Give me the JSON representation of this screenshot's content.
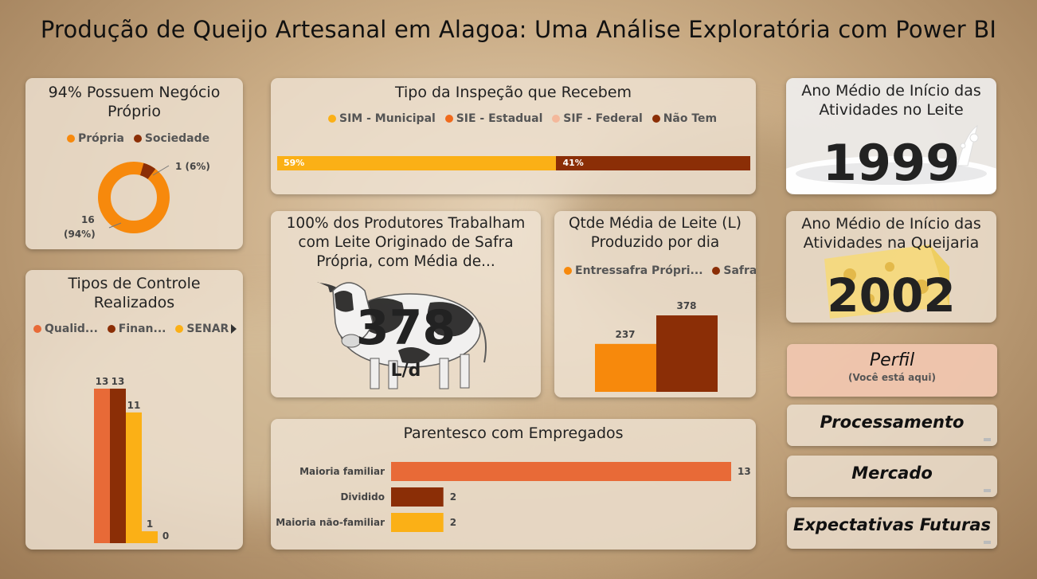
{
  "page_title": "Produção de Queijo Artesanal em Alagoa: Uma Análise Exploratória com Power BI",
  "colors": {
    "orange": "#F7890C",
    "darkred": "#8B2E06",
    "yellow": "#FBB016",
    "coral": "#E86A37",
    "salmon": "#F4B89B",
    "active_nav": "#F0C6AF"
  },
  "negocio": {
    "title": "94% Possuem Negócio Próprio",
    "legend": [
      {
        "label": "Própria",
        "color": "#F7890C"
      },
      {
        "label": "Sociedade",
        "color": "#8B2E06"
      }
    ],
    "slices": [
      {
        "label": "Própria",
        "value": 16,
        "pct": "(94%)",
        "display": "16"
      },
      {
        "label": "Sociedade",
        "value": 1,
        "display": "1 (6%)"
      }
    ]
  },
  "inspecao": {
    "title": "Tipo da Inspeção que Recebem",
    "legend": [
      {
        "label": "SIM - Municipal",
        "color": "#FBB016"
      },
      {
        "label": "SIE - Estadual",
        "color": "#F06A1C"
      },
      {
        "label": "SIF - Federal",
        "color": "#F4B89B"
      },
      {
        "label": "Não Tem",
        "color": "#8B2E06"
      }
    ],
    "segments": [
      {
        "label": "SIM - Municipal",
        "pct": 59,
        "display": "59%"
      },
      {
        "label": "Não Tem",
        "pct": 41,
        "display": "41%"
      }
    ]
  },
  "ano_leite": {
    "title": "Ano Médio de Início das Atividades no Leite",
    "value": "1999"
  },
  "ano_queijaria": {
    "title": "Ano Médio de Início das Atividades na Queijaria",
    "value": "2002"
  },
  "safra": {
    "title": "100% dos Produtores Trabalham com Leite Originado de Safra Própria, com Média de...",
    "value": "378",
    "unit": "L/d",
    "icon": "cow-icon"
  },
  "leite_dia": {
    "title": "Qtde Média de Leite (L) Produzido por dia",
    "legend": [
      {
        "label": "Entressafra Própri...",
        "color": "#F7890C"
      },
      {
        "label": "Safra",
        "color": "#8B2E06"
      }
    ],
    "chart_data": {
      "type": "bar",
      "categories": [
        "Entressafra Própria",
        "Safra"
      ],
      "values": [
        237,
        378
      ],
      "title": "Qtde Média de Leite (L) Produzido por dia",
      "ylim": [
        0,
        378
      ]
    }
  },
  "controle": {
    "title": "Tipos de Controle Realizados",
    "legend": [
      {
        "label": "Qualid...",
        "color": "#E86A37"
      },
      {
        "label": "Finan...",
        "color": "#8B2E06"
      },
      {
        "label": "SENAR",
        "color": "#FBB016"
      }
    ],
    "chart_data": {
      "type": "bar",
      "series": [
        {
          "name": "Qualid...",
          "values": [
            13
          ]
        },
        {
          "name": "Finan...",
          "values": [
            13
          ]
        },
        {
          "name": "SENAR",
          "values": [
            11
          ]
        },
        {
          "name": "",
          "values": [
            1
          ]
        },
        {
          "name": "",
          "values": [
            0
          ]
        }
      ],
      "ylim": [
        0,
        13
      ]
    }
  },
  "parentesco": {
    "title": "Parentesco com Empregados",
    "chart_data": {
      "type": "bar",
      "categories": [
        "Maioria familiar",
        "Dividido",
        "Maioria não-familiar"
      ],
      "values": [
        13,
        2,
        2
      ],
      "title": "Parentesco com Empregados",
      "xlim": [
        0,
        13
      ]
    }
  },
  "nav": {
    "perfil": "Perfil",
    "perfil_sub": "(Você está aqui)",
    "processamento": "Processamento",
    "mercado": "Mercado",
    "expectativas": "Expectativas Futuras"
  }
}
